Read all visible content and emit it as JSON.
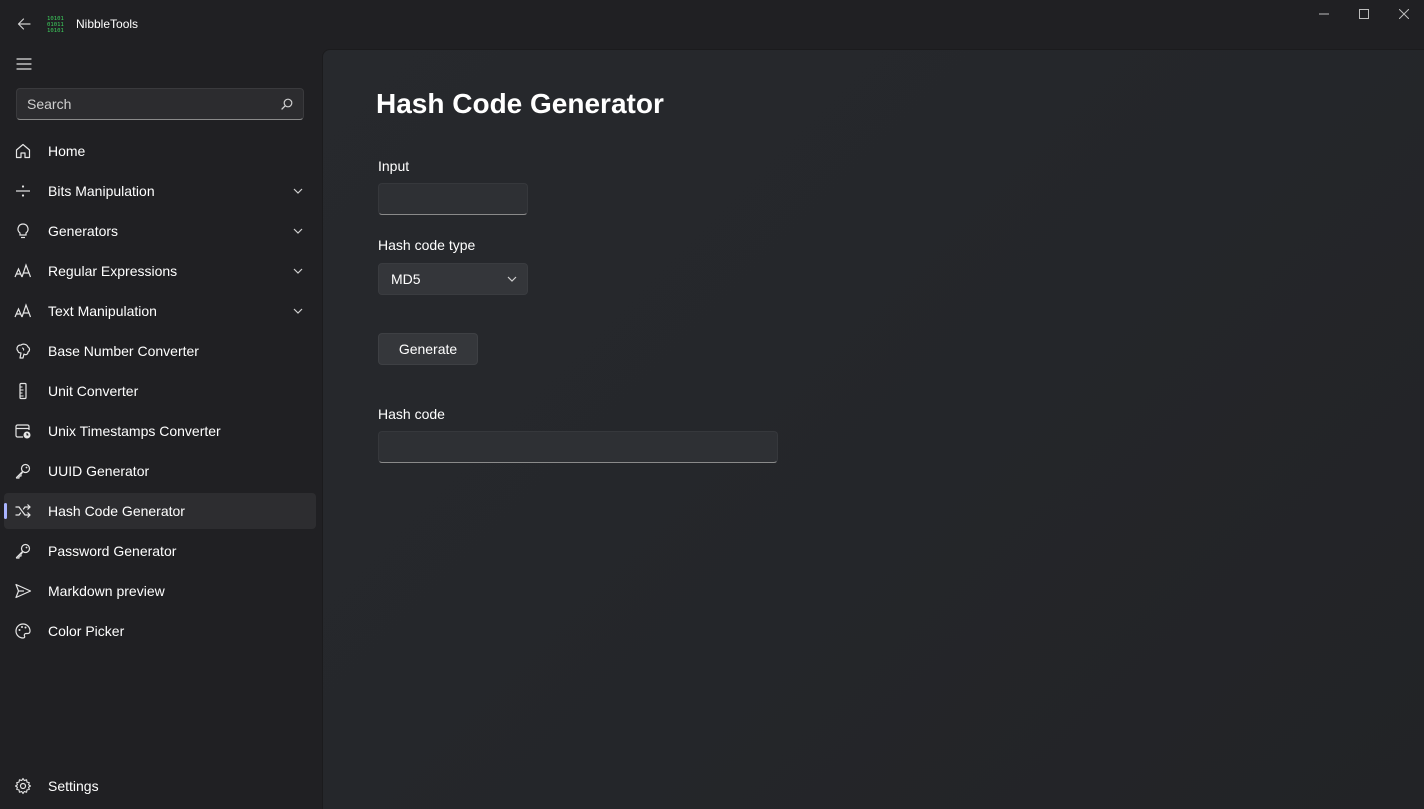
{
  "app": {
    "title": "NibbleTools"
  },
  "colors": {
    "accent": "#a9b4ff",
    "logo": "#3ccc5c",
    "background": "#202023"
  },
  "sidebar": {
    "search_placeholder": "Search",
    "items": [
      {
        "label": "Home",
        "icon": "home-icon",
        "expandable": false,
        "selected": false
      },
      {
        "label": "Bits Manipulation",
        "icon": "bits-icon",
        "expandable": true,
        "selected": false
      },
      {
        "label": "Generators",
        "icon": "lightbulb-icon",
        "expandable": true,
        "selected": false
      },
      {
        "label": "Regular Expressions",
        "icon": "font-size-icon",
        "expandable": true,
        "selected": false
      },
      {
        "label": "Text Manipulation",
        "icon": "font-size-icon",
        "expandable": true,
        "selected": false
      },
      {
        "label": "Base Number Converter",
        "icon": "brain-icon",
        "expandable": false,
        "selected": false
      },
      {
        "label": "Unit Converter",
        "icon": "ruler-icon",
        "expandable": false,
        "selected": false
      },
      {
        "label": "Unix Timestamps Converter",
        "icon": "calendar-clock-icon",
        "expandable": false,
        "selected": false
      },
      {
        "label": "UUID Generator",
        "icon": "key-icon",
        "expandable": false,
        "selected": false
      },
      {
        "label": "Hash Code Generator",
        "icon": "shuffle-icon",
        "expandable": false,
        "selected": true
      },
      {
        "label": "Password Generator",
        "icon": "key-icon",
        "expandable": false,
        "selected": false
      },
      {
        "label": "Markdown preview",
        "icon": "send-icon",
        "expandable": false,
        "selected": false
      },
      {
        "label": "Color Picker",
        "icon": "palette-icon",
        "expandable": false,
        "selected": false
      }
    ],
    "settings_label": "Settings"
  },
  "main": {
    "title": "Hash Code Generator",
    "input_label": "Input",
    "input_value": "",
    "hash_type_label": "Hash code type",
    "hash_type_value": "MD5",
    "generate_label": "Generate",
    "hash_code_label": "Hash code",
    "hash_code_value": ""
  }
}
